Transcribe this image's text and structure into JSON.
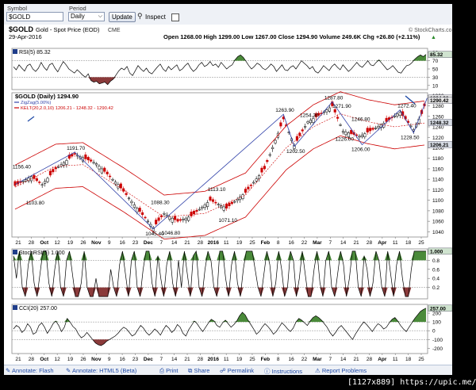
{
  "toolbar": {
    "symbol_label": "Symbol",
    "symbol_value": "$GOLD",
    "period_label": "Period",
    "period_value": "Daily",
    "update_label": "Update",
    "inspect_label": "Inspect",
    "inspect_checked": false
  },
  "header": {
    "title": "$GOLD",
    "description": "Gold - Spot Price (EOD)",
    "exchange": "CME",
    "date": "29-Apr-2016",
    "ohlc": "Open 1268.00  High 1299.00  Low 1267.00  Close 1294.90  Volume 249.6K  Chg +26.80 (+2.11%)",
    "change_arrow": "▲",
    "attribution": "© StockCharts.com"
  },
  "bottom_bar": {
    "annotate_flash": "Annotate: Flash",
    "annotate_html5": "Annotate: HTML5 (Beta)",
    "print": "Print",
    "share": "Share",
    "permalink": "Permalink",
    "instructions": "Instructions",
    "report": "Report Problems"
  },
  "watermark": "[1127x889] https://upic.me/",
  "colors": {
    "frame": "#000000",
    "up_candle": "#000000",
    "down_candle": "#cc0000",
    "zigzag": "#3344aa",
    "kelt_band": "#cc0000",
    "kelt_mid": "#cc0000",
    "osc_line": "#000000",
    "fill_high": "#4a8a3a",
    "fill_low": "#8a3a3a",
    "guide": "#a0a0a0",
    "toolbar_bg": "#eef1f6",
    "link": "#1f4aa6",
    "price_tag_bg": "#d8dde6",
    "arrow": "#1f4aa6"
  },
  "chart_data": [
    {
      "type": "candlestick",
      "title": "$GOLD (Daily) 1294.90",
      "legend": [
        {
          "label": "ZigZag(5.00%)",
          "color": "#3344aa"
        },
        {
          "label": "KELT(20,2.0,10) 1206.21 - 1248.32 - 1290.42",
          "color": "#cc0000"
        }
      ],
      "x_tick_labels": [
        "21",
        "28",
        "Oct",
        "12",
        "19",
        "26",
        "Nov",
        "9",
        "16",
        "23",
        "Dec",
        "7",
        "14",
        "21",
        "28",
        "2016",
        "11",
        "19",
        "25",
        "Feb",
        "8",
        "16",
        "22",
        "Mar",
        "7",
        "14",
        "21",
        "28",
        "Apr",
        "11",
        "18",
        "25"
      ],
      "y_ticks": [
        1040,
        1060,
        1080,
        1100,
        1120,
        1140,
        1160,
        1180,
        1200,
        1220,
        1240,
        1260,
        1280,
        1300
      ],
      "ylim": [
        1030,
        1305
      ],
      "last_price_tags": [
        {
          "value": "1294.90",
          "level": 1294.9
        },
        {
          "value": "1290.42",
          "level": 1290.42
        },
        {
          "value": "1248.32",
          "level": 1248.32
        },
        {
          "value": "1206.21",
          "level": 1206.21
        }
      ],
      "zigzag_annotations": [
        {
          "label": "1156.40",
          "i": 2,
          "v": 1156.4
        },
        {
          "label": "1103.80",
          "i": 7,
          "v": 1103.8
        },
        {
          "label": "1191.70",
          "i": 22,
          "v": 1191.7
        },
        {
          "label": "1045.40",
          "i": 51,
          "v": 1045.4
        },
        {
          "label": "1088.30",
          "i": 53,
          "v": 1088.3
        },
        {
          "label": "1046.80",
          "i": 57,
          "v": 1046.8
        },
        {
          "label": "1113.10",
          "i": 74,
          "v": 1113.1
        },
        {
          "label": "1071.10",
          "i": 78,
          "v": 1071.1
        },
        {
          "label": "1263.90",
          "i": 99,
          "v": 1263.9
        },
        {
          "label": "1202.50",
          "i": 103,
          "v": 1202.5
        },
        {
          "label": "1254.30",
          "i": 108,
          "v": 1254.3
        },
        {
          "label": "1287.80",
          "i": 117,
          "v": 1287.8
        },
        {
          "label": "1271.90",
          "i": 120,
          "v": 1271.9
        },
        {
          "label": "1226.00",
          "i": 121,
          "v": 1226.0
        },
        {
          "label": "1246.80",
          "i": 127,
          "v": 1246.8
        },
        {
          "label": "1206.00",
          "i": 127,
          "v": 1206.0
        },
        {
          "label": "1272.40",
          "i": 144,
          "v": 1272.4
        },
        {
          "label": "1228.50",
          "i": 147,
          "v": 1228.5
        }
      ],
      "zigzag_points": [
        [
          0,
          1130
        ],
        [
          22,
          1191.7
        ],
        [
          51,
          1045.4
        ],
        [
          99,
          1263.9
        ],
        [
          103,
          1202.5
        ],
        [
          117,
          1287.8
        ],
        [
          128,
          1206
        ],
        [
          142,
          1272.4
        ],
        [
          147,
          1228.5
        ],
        [
          152,
          1294.9
        ]
      ],
      "keltner_mid": [
        [
          0,
          1125
        ],
        [
          15,
          1165
        ],
        [
          25,
          1168
        ],
        [
          40,
          1120
        ],
        [
          55,
          1068
        ],
        [
          70,
          1075
        ],
        [
          85,
          1110
        ],
        [
          100,
          1200
        ],
        [
          110,
          1240
        ],
        [
          120,
          1265
        ],
        [
          130,
          1250
        ],
        [
          140,
          1240
        ],
        [
          152,
          1248
        ]
      ],
      "close_path": [
        [
          0,
          1128
        ],
        [
          6,
          1145
        ],
        [
          10,
          1130
        ],
        [
          15,
          1160
        ],
        [
          22,
          1188
        ],
        [
          30,
          1170
        ],
        [
          38,
          1130
        ],
        [
          45,
          1085
        ],
        [
          51,
          1048
        ],
        [
          55,
          1075
        ],
        [
          60,
          1060
        ],
        [
          65,
          1070
        ],
        [
          72,
          1100
        ],
        [
          78,
          1085
        ],
        [
          85,
          1115
        ],
        [
          92,
          1160
        ],
        [
          99,
          1255
        ],
        [
          103,
          1205
        ],
        [
          108,
          1250
        ],
        [
          113,
          1265
        ],
        [
          117,
          1280
        ],
        [
          121,
          1232
        ],
        [
          127,
          1222
        ],
        [
          132,
          1235
        ],
        [
          137,
          1250
        ],
        [
          142,
          1268
        ],
        [
          147,
          1235
        ],
        [
          150,
          1265
        ],
        [
          152,
          1294.9
        ]
      ],
      "candle_count": 152
    },
    {
      "type": "line",
      "title": "RSI(5) 85.32",
      "y_ticks": [
        10,
        30,
        50,
        70,
        90
      ],
      "ylim": [
        0,
        100
      ],
      "guides": [
        30,
        70
      ],
      "high_threshold": 70,
      "low_threshold": 30,
      "last_value_tag": "85.32",
      "values": [
        55,
        48,
        60,
        52,
        45,
        58,
        62,
        50,
        44,
        52,
        66,
        54,
        47,
        60,
        64,
        52,
        43,
        56,
        68,
        60,
        50,
        45,
        40,
        48,
        42,
        35,
        30,
        38,
        22,
        18,
        20,
        14,
        16,
        18,
        12,
        20,
        25,
        35,
        45,
        52,
        48,
        56,
        40,
        34,
        46,
        58,
        50,
        44,
        52,
        42,
        38,
        47,
        55,
        62,
        50,
        44,
        56,
        48,
        54,
        60,
        46,
        50,
        58,
        64,
        52,
        44,
        50,
        60,
        66,
        56,
        60,
        68,
        58,
        62,
        54,
        66,
        58,
        50,
        56,
        60,
        72,
        80,
        84,
        78,
        68,
        58,
        50,
        56,
        64,
        60,
        52,
        48,
        54,
        62,
        56,
        44,
        52,
        60,
        48,
        46,
        54,
        58,
        50,
        60,
        70,
        64,
        58,
        50,
        56,
        44,
        40,
        48,
        58,
        52,
        46,
        56,
        62,
        54,
        48,
        60,
        52,
        44,
        50,
        58,
        66,
        58,
        54,
        62,
        70,
        60,
        58,
        66,
        72,
        64,
        56,
        48,
        52,
        58,
        50,
        42,
        40,
        50,
        58,
        60,
        66,
        74,
        80,
        84,
        80,
        85.32
      ]
    },
    {
      "type": "line",
      "title": "StochRSI(5) 1.000",
      "y_ticks": [
        0.2,
        0.4,
        0.6,
        0.8,
        1.0
      ],
      "ylim": [
        -0.05,
        1.05
      ],
      "guides": [
        0.2,
        0.8
      ],
      "high_threshold": 0.8,
      "low_threshold": 0.2,
      "last_value_tag": "1.000",
      "values": [
        0.9,
        0.4,
        1,
        0.2,
        0,
        0.7,
        1,
        0.3,
        0,
        0.5,
        1,
        1,
        0.3,
        0,
        0.6,
        1,
        0.2,
        0,
        0.8,
        1,
        0.5,
        0,
        0,
        0.3,
        1,
        0.2,
        0,
        0,
        0.4,
        0,
        0,
        0,
        0,
        0.6,
        0.2,
        0,
        0.7,
        1,
        0.5,
        0,
        0.8,
        1,
        0.2,
        0,
        0.6,
        1,
        1,
        0.3,
        0,
        0.9,
        0.4,
        0,
        0.7,
        1,
        0.3,
        0,
        0.8,
        0.2,
        1,
        0.5,
        0,
        0.9,
        1,
        0.2,
        0,
        0.6,
        1,
        0.8,
        0.2,
        0,
        1,
        1,
        0.4,
        0,
        0.7,
        1,
        0.3,
        0,
        0.6,
        1,
        1,
        1,
        0.6,
        0.2,
        0,
        0.5,
        1,
        0.7,
        0,
        0.3,
        1,
        0.6,
        0,
        0.2,
        1,
        0.8,
        0,
        0.4,
        1,
        0.5,
        0,
        0,
        0.6,
        1,
        0.3,
        0,
        0.8,
        1,
        0.2,
        0,
        0.5,
        1,
        0.7,
        0,
        0.4,
        1,
        1,
        0.2,
        0,
        0.9,
        0.6,
        0,
        0.3,
        1,
        0.8,
        0.2,
        0,
        1,
        0.5,
        0,
        0.7,
        1,
        0.4,
        0,
        0,
        0.6,
        1,
        1,
        1,
        1,
        1.0
      ]
    },
    {
      "type": "area",
      "title": "CCI(20) 257.00",
      "y_ticks": [
        -200,
        -100,
        0,
        100,
        200
      ],
      "ylim": [
        -260,
        300
      ],
      "guides": [
        -100,
        0,
        100
      ],
      "high_threshold": 100,
      "low_threshold": -100,
      "last_value_tag": "257.00",
      "values": [
        20,
        60,
        40,
        -20,
        10,
        80,
        40,
        -40,
        -20,
        60,
        90,
        40,
        -30,
        20,
        80,
        110,
        60,
        -10,
        40,
        140,
        100,
        50,
        20,
        -40,
        -80,
        -60,
        -20,
        -60,
        -100,
        -140,
        -160,
        -170,
        -150,
        -120,
        -100,
        -80,
        -60,
        -30,
        10,
        40,
        20,
        -20,
        -60,
        -40,
        10,
        60,
        30,
        -20,
        -50,
        -20,
        20,
        -10,
        -50,
        10,
        60,
        30,
        -20,
        10,
        70,
        40,
        -30,
        -60,
        10,
        60,
        110,
        80,
        30,
        -10,
        40,
        90,
        130,
        110,
        60,
        40,
        90,
        120,
        80,
        40,
        70,
        110,
        170,
        210,
        180,
        120,
        70,
        20,
        -40,
        -10,
        40,
        80,
        50,
        10,
        -40,
        -10,
        40,
        90,
        60,
        20,
        -10,
        30,
        100,
        140,
        120,
        90,
        60,
        110,
        150,
        170,
        150,
        120,
        80,
        40,
        -20,
        -60,
        -20,
        30,
        60,
        20,
        -20,
        -60,
        -100,
        -40,
        10,
        60,
        100,
        70,
        30,
        -10,
        40,
        80,
        60,
        20,
        40,
        90,
        130,
        150,
        110,
        60,
        20,
        -10,
        40,
        90,
        140,
        180,
        220,
        240,
        257
      ]
    }
  ]
}
